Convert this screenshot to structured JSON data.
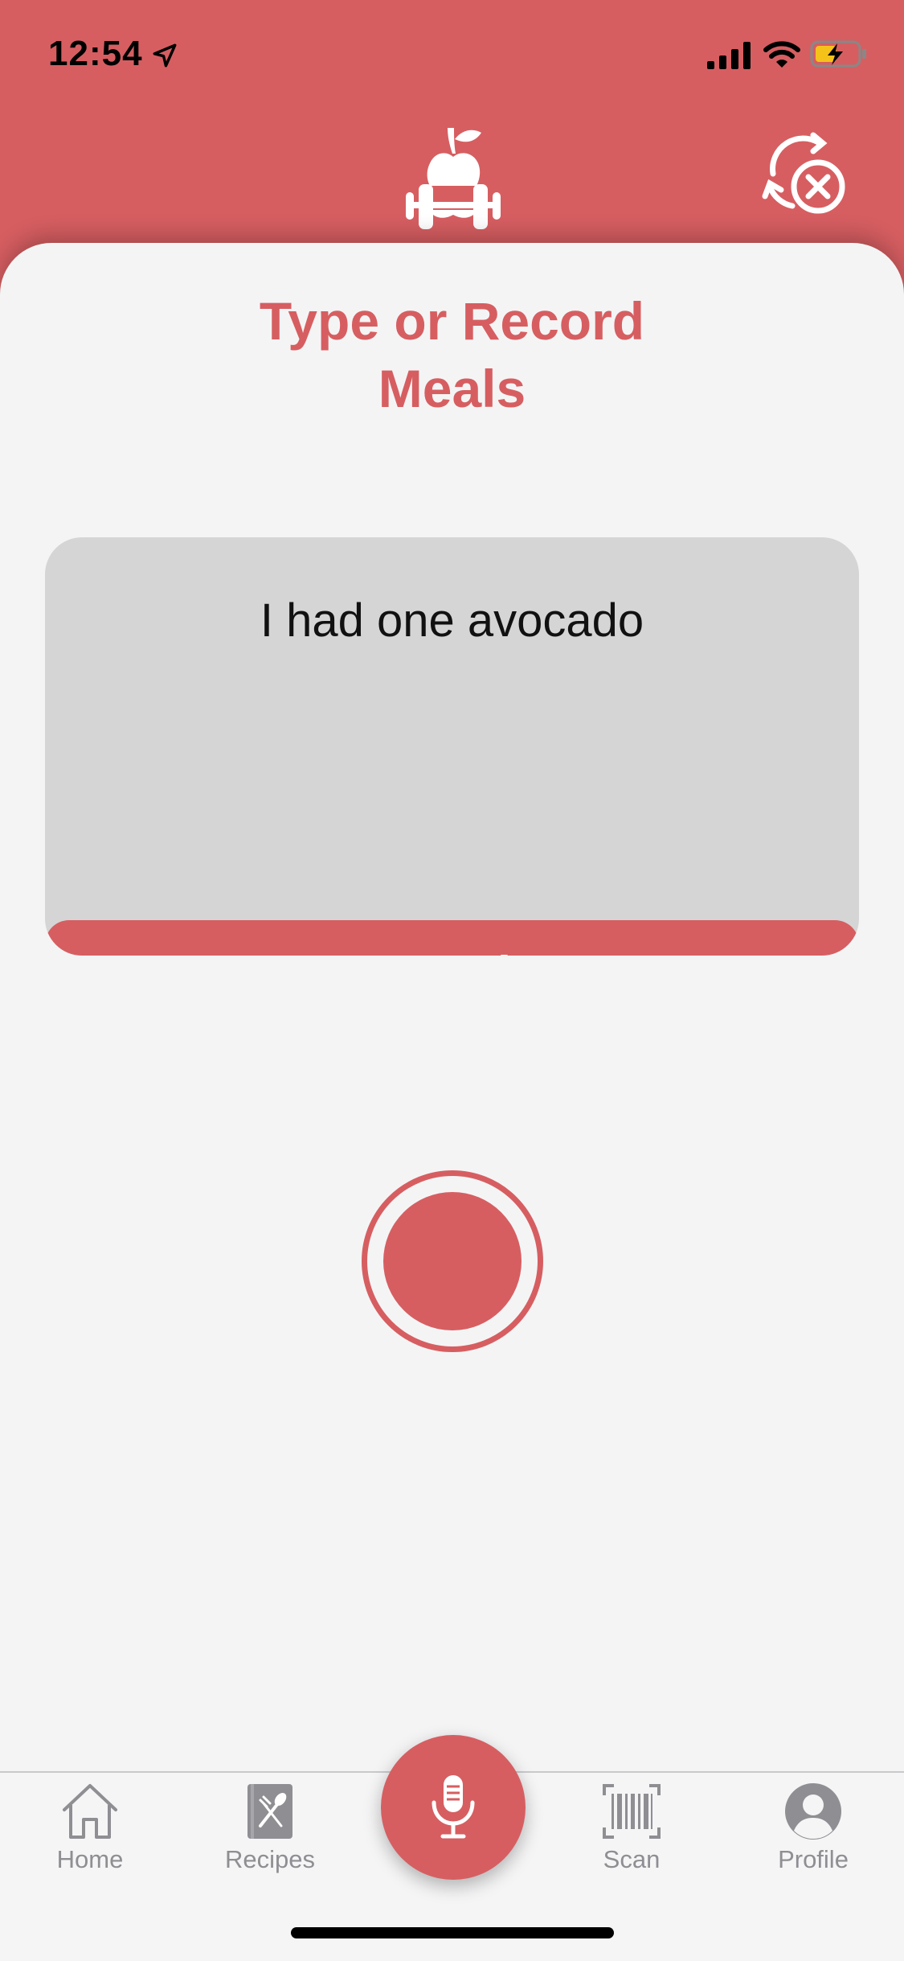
{
  "status_bar": {
    "time": "12:54",
    "icons": [
      "location-arrow-icon",
      "cellular-signal-icon",
      "wifi-icon",
      "battery-charging-icon"
    ]
  },
  "header": {
    "logo_icon": "apple-dumbbell-logo-icon",
    "reset_icon": "reset-cancel-icon"
  },
  "main": {
    "title_line1": "Type or Record",
    "title_line2": "Meals",
    "meal_input_value": "I had one avocado",
    "send_label": "Send",
    "record_icon": "record-circle-icon"
  },
  "tab_bar": {
    "items": [
      {
        "label": "Home",
        "icon": "house-icon"
      },
      {
        "label": "Recipes",
        "icon": "recipe-book-icon"
      },
      {
        "label": "Scan",
        "icon": "barcode-icon"
      },
      {
        "label": "Profile",
        "icon": "user-circle-icon"
      }
    ],
    "center_icon": "microphone-icon"
  },
  "colors": {
    "accent": "#d65e61",
    "background": "#f4f4f5",
    "input_background": "#d5d5d5",
    "tab_inactive": "#8e8e93"
  }
}
